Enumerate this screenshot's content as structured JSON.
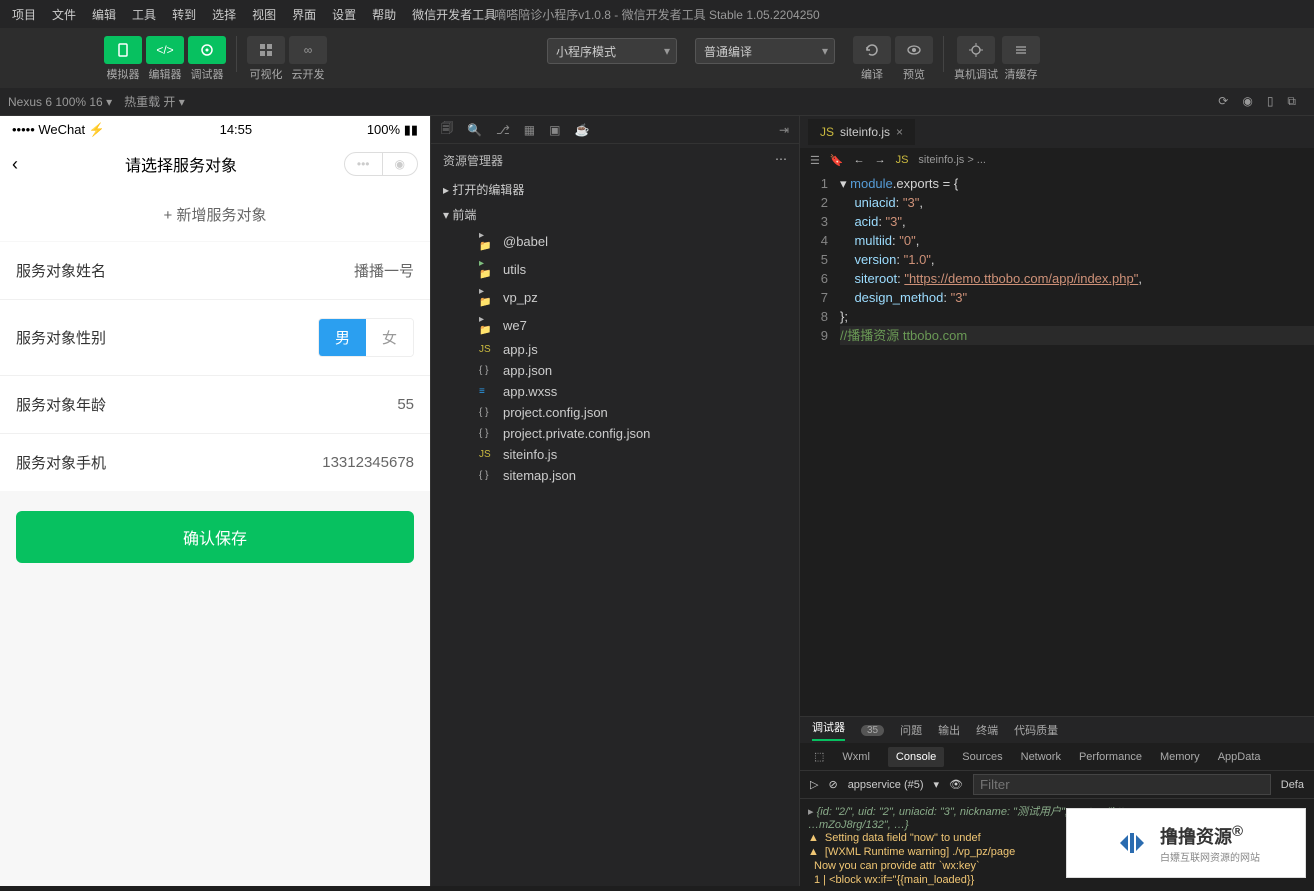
{
  "menubar": [
    "项目",
    "文件",
    "编辑",
    "工具",
    "转到",
    "选择",
    "视图",
    "界面",
    "设置",
    "帮助",
    "微信开发者工具"
  ],
  "window_title": "嘀嗒陪诊小程序v1.0.8 - 微信开发者工具 Stable 1.05.2204250",
  "toolbar": {
    "simulator": "模拟器",
    "editor": "编辑器",
    "debugger": "调试器",
    "visual": "可视化",
    "cloud": "云开发",
    "mode": "小程序模式",
    "compile_mode": "普通编译",
    "compile": "编译",
    "preview": "预览",
    "remote": "真机调试",
    "clear": "清缓存"
  },
  "statusbar": {
    "device": "Nexus 6 100% 16 ▾",
    "hotreload": "热重载 开 ▾"
  },
  "phone": {
    "carrier": "••••• WeChat ⚡",
    "time": "14:55",
    "battery": "100%",
    "title": "请选择服务对象",
    "add": "+ 新增服务对象",
    "rows": {
      "name_lbl": "服务对象姓名",
      "name_val": "播播一号",
      "gender_lbl": "服务对象性别",
      "male": "男",
      "female": "女",
      "age_lbl": "服务对象年龄",
      "age_val": "55",
      "phone_lbl": "服务对象手机",
      "phone_val": "13312345678"
    },
    "confirm": "确认保存"
  },
  "explorer": {
    "title": "资源管理器",
    "open_editors": "打开的编辑器",
    "root": "前端",
    "items": [
      {
        "t": "folder",
        "n": "@babel"
      },
      {
        "t": "folder-g",
        "n": "utils"
      },
      {
        "t": "folder",
        "n": "vp_pz"
      },
      {
        "t": "folder",
        "n": "we7"
      },
      {
        "t": "js",
        "n": "app.js"
      },
      {
        "t": "json",
        "n": "app.json"
      },
      {
        "t": "wxss",
        "n": "app.wxss"
      },
      {
        "t": "json",
        "n": "project.config.json"
      },
      {
        "t": "json",
        "n": "project.private.config.json"
      },
      {
        "t": "js",
        "n": "siteinfo.js"
      },
      {
        "t": "json",
        "n": "sitemap.json"
      }
    ]
  },
  "editor_tab": "siteinfo.js",
  "breadcrumb": "siteinfo.js > ...",
  "code": {
    "l1a": "module",
    "l1b": ".exports = {",
    "l2p": "uniacid",
    "l2v": "\"3\"",
    "l3p": "acid",
    "l3v": "\"3\"",
    "l4p": "multiid",
    "l4v": "\"0\"",
    "l5p": "version",
    "l5v": "\"1.0\"",
    "l6p": "siteroot",
    "l6v": "\"https://demo.ttbobo.com/app/index.php\"",
    "l7p": "design_method",
    "l7v": "\"3\"",
    "l8": "};",
    "l9": "//播播资源 ttbobo.com"
  },
  "debugger": {
    "tab": "调试器",
    "count": "35",
    "subtabs": [
      "问题",
      "输出",
      "终端",
      "代码质量"
    ],
    "devtabs": [
      "Wxml",
      "Console",
      "Sources",
      "Network",
      "Performance",
      "Memory",
      "AppData"
    ],
    "context": "appservice (#5)",
    "filter_ph": "Filter",
    "default": "Defa",
    "row0": "{id: \"2/\", uid: \"2\", uniacid: \"3\", nickname: \"测试用户\", avatar: \"https:…",
    "row0b": "…mZoJ8rg/132\", …}",
    "lines": [
      "Setting data field \"now\" to undef",
      "[WXML Runtime warning] ./vp_pz/page",
      "Now you can provide attr `wx:key`",
      "1 | <block wx:if=\"{{main_loaded}}"
    ]
  },
  "logo": {
    "brand": "撸撸资源",
    "tag": "白嫖互联网资源的网站",
    "r": "®"
  }
}
